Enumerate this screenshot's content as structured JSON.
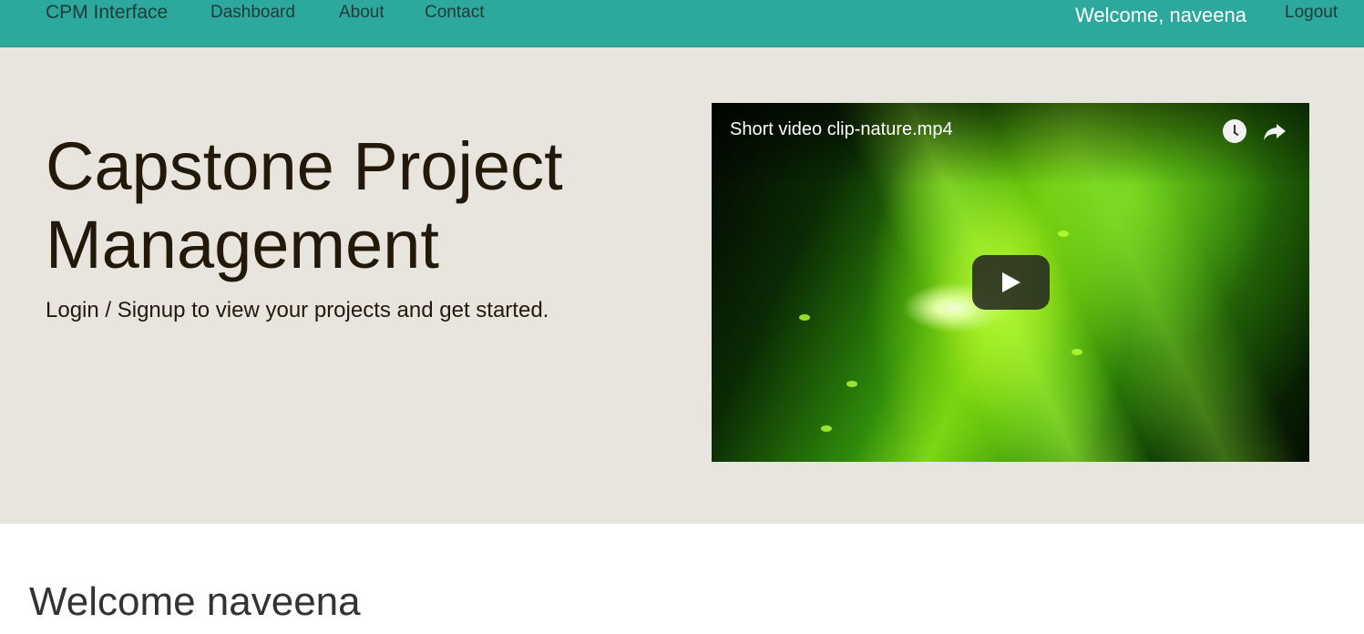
{
  "navbar": {
    "brand": "CPM Interface",
    "links": [
      "Dashboard",
      "About",
      "Contact"
    ],
    "welcome": "Welcome, naveena",
    "logout": "Logout"
  },
  "hero": {
    "title": "Capstone Project Management",
    "subtitle": "Login / Signup to view your projects and get started."
  },
  "video": {
    "title": "Short video clip-nature.mp4",
    "icons": [
      "watch-later-icon",
      "share-icon",
      "play-icon"
    ]
  },
  "content": {
    "heading": "Welcome naveena"
  },
  "colors": {
    "navbar": "#2ca89d",
    "hero_bg": "#e8e5de",
    "text_dark": "#23190a"
  }
}
